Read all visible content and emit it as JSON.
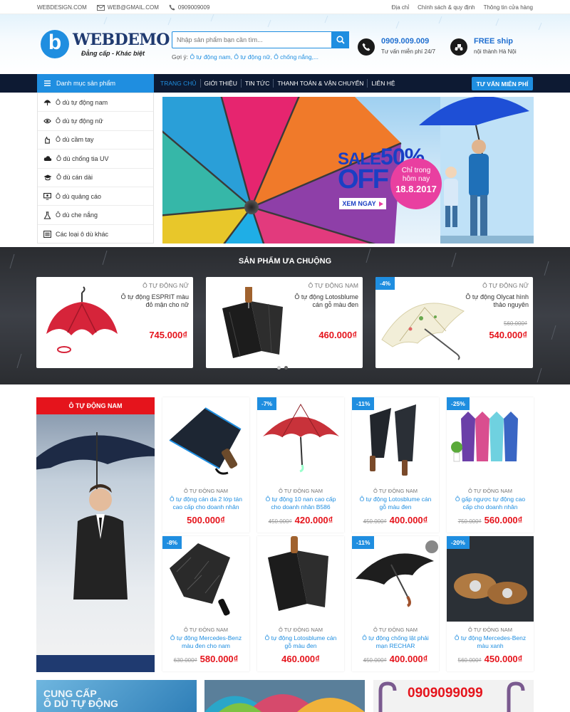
{
  "topbar": {
    "site": "WEBDESIGN.COM",
    "email": "WEB@GMAIL.COM",
    "phone": "0909009009",
    "links": [
      "Địa chỉ",
      "Chính sách & quy định",
      "Thông tin cửa hàng"
    ]
  },
  "header": {
    "logo_letter": "b",
    "logo_text": "WEBDEMO",
    "tagline": "Đẳng cấp - Khác biệt",
    "search_placeholder": "Nhập sản phẩm bạn cần tìm...",
    "hint_label": "Gợi ý:",
    "hints": [
      "Ô tự động nam,",
      "Ô tự động nữ,",
      "Ô chống nắng,..."
    ],
    "hotline": "0909.009.009",
    "hotline_sub": "Tư vấn miễn phí 24/7",
    "ship": "FREE ship",
    "ship_sub": "nội thành Hà Nội"
  },
  "nav": {
    "category_title": "Danh mục sản phẩm",
    "menu": [
      "TRANG CHỦ",
      "GIỚI THIỆU",
      "TIN TỨC",
      "THANH TOÁN & VẬN CHUYỂN",
      "LIÊN HỆ"
    ],
    "consult": "TƯ VẤN MIỄN PHÍ"
  },
  "sidebar": {
    "items": [
      {
        "label": "Ô dù tự động nam",
        "icon": "umbrella-icon"
      },
      {
        "label": "Ô dù tự động nữ",
        "icon": "eye-icon"
      },
      {
        "label": "Ô dù cầm tay",
        "icon": "hand-icon"
      },
      {
        "label": "Ô dù chống tia UV",
        "icon": "cloud-icon"
      },
      {
        "label": "Ô dù cán dài",
        "icon": "graduation-icon"
      },
      {
        "label": "Ô dù quảng cáo",
        "icon": "monitor-icon"
      },
      {
        "label": "Ô dù che nắng",
        "icon": "flask-icon"
      },
      {
        "label": "Các loại ô dù khác",
        "icon": "list-icon"
      }
    ]
  },
  "banner": {
    "sale": "SALE",
    "percent": "50%",
    "off": "OFF",
    "promo_line1": "Chỉ trong",
    "promo_line2": "hôm nay",
    "promo_date": "18.8.2017",
    "cta": "XEM NGAY"
  },
  "popular": {
    "title": "SẢN PHẨM ƯA CHUỘNG",
    "items": [
      {
        "category": "Ô TỰ ĐỘNG NỮ",
        "name": "Ô tự động ESPRIT màu đỏ mận cho nữ",
        "old_price": "",
        "price": "745.000₫",
        "badge": "",
        "color": "#d6243a"
      },
      {
        "category": "Ô TỰ ĐỘNG NAM",
        "name": "Ô tự động Lotosblume cán gỗ màu đen",
        "old_price": "",
        "price": "460.000₫",
        "badge": "",
        "color": "#1c1c1c"
      },
      {
        "category": "Ô TỰ ĐỘNG NỮ",
        "name": "Ô tự động Olycat hình thảo nguyên",
        "old_price": "560.000₫",
        "price": "540.000₫",
        "badge": "-4%",
        "color": "#f0ecd8"
      }
    ]
  },
  "male": {
    "title": "Ô TỰ ĐỘNG NAM",
    "products": [
      {
        "category": "Ô TỰ ĐỘNG NAM",
        "name": "Ô tự động cán da 2 lớp tán cao cấp cho doanh nhân",
        "old_price": "",
        "price": "500.000₫",
        "badge": "",
        "color": "#1d2633"
      },
      {
        "category": "Ô TỰ ĐỘNG NAM",
        "name": "Ô tự động 10 nan cao cấp cho doanh nhân B586",
        "old_price": "450.000₫",
        "price": "420.000₫",
        "badge": "-7%",
        "color": "#c8323a"
      },
      {
        "category": "Ô TỰ ĐỘNG NAM",
        "name": "Ô tự động Lotosblume cán gỗ màu đen",
        "old_price": "450.000₫",
        "price": "400.000₫",
        "badge": "-11%",
        "color": "#22262c"
      },
      {
        "category": "Ô TỰ ĐỘNG NAM",
        "name": "Ô gấp ngược tự động cao cấp cho doanh nhân",
        "old_price": "750.000₫",
        "price": "560.000₫",
        "badge": "-25%",
        "color": "#7a5cc4"
      },
      {
        "category": "Ô TỰ ĐỘNG NAM",
        "name": "Ô tự động Mercedes-Benz màu đen cho nam",
        "old_price": "630.000₫",
        "price": "580.000₫",
        "badge": "-8%",
        "color": "#2a2a2a"
      },
      {
        "category": "Ô TỰ ĐỘNG NAM",
        "name": "Ô tự động Lotosblume cán gỗ màu đen",
        "old_price": "",
        "price": "460.000₫",
        "badge": "",
        "color": "#1c1c1c"
      },
      {
        "category": "Ô TỰ ĐỘNG NAM",
        "name": "Ô tự động chống lật phải mạn RECHAR",
        "old_price": "450.000₫",
        "price": "400.000₫",
        "badge": "-11%",
        "color": "#1e1e1e"
      },
      {
        "category": "Ô TỰ ĐỘNG NAM",
        "name": "Ô tự động Mercedes-Benz màu xanh",
        "old_price": "560.000₫",
        "price": "450.000₫",
        "badge": "-20%",
        "color": "#2b3036"
      }
    ]
  },
  "bottom": {
    "banner1_line1": "CUNG CẤP",
    "banner1_line2": "Ô DÙ TỰ ĐỘNG",
    "banner3_phone": "0909099099"
  },
  "colors": {
    "accent": "#1f8ee0",
    "nav": "#0d1a33",
    "price": "#e5141c",
    "section": "#e5141c"
  }
}
